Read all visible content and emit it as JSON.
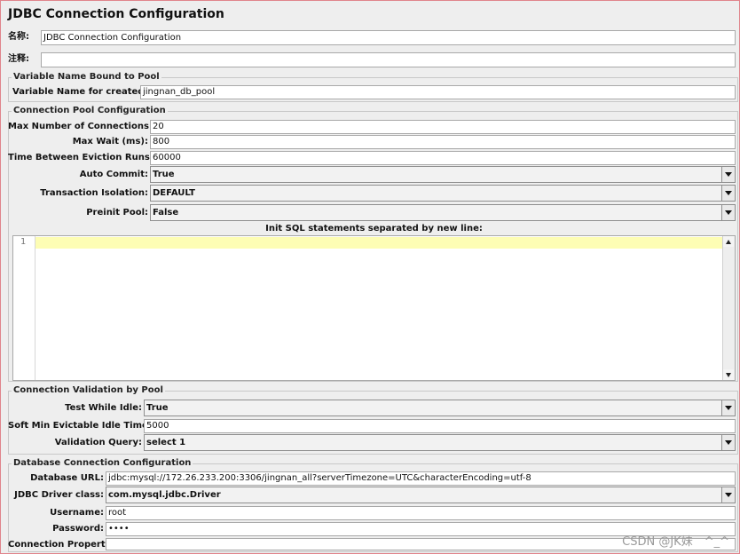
{
  "title": "JDBC Connection Configuration",
  "name": {
    "label": "名称:",
    "value": "JDBC Connection Configuration"
  },
  "comments": {
    "label": "注释:",
    "value": ""
  },
  "variable_group": {
    "title": "Variable Name Bound to Pool",
    "label": "Variable Name for created pool:",
    "value": "jingnan_db_pool"
  },
  "pool_group": {
    "title": "Connection Pool Configuration",
    "max_connections": {
      "label": "Max Number of Connections:",
      "value": "20"
    },
    "max_wait": {
      "label": "Max Wait (ms):",
      "value": "800"
    },
    "eviction": {
      "label": "Time Between Eviction Runs (ms):",
      "value": "60000"
    },
    "auto_commit": {
      "label": "Auto Commit:",
      "value": "True"
    },
    "isolation": {
      "label": "Transaction Isolation:",
      "value": "DEFAULT"
    },
    "preinit": {
      "label": "Preinit Pool:",
      "value": "False"
    },
    "init_sql_label": "Init SQL statements separated by new line:",
    "editor_line": "1"
  },
  "validation_group": {
    "title": "Connection Validation by Pool",
    "test_idle": {
      "label": "Test While Idle:",
      "value": "True"
    },
    "soft_min": {
      "label": "Soft Min Evictable Idle Time(ms):",
      "value": "5000"
    },
    "validation_query": {
      "label": "Validation Query:",
      "value": "select 1"
    }
  },
  "db_group": {
    "title": "Database Connection Configuration",
    "url": {
      "label": "Database URL:",
      "value": "jdbc:mysql://172.26.233.200:3306/jingnan_all?serverTimezone=UTC&characterEncoding=utf-8"
    },
    "driver": {
      "label": "JDBC Driver class:",
      "value": "com.mysql.jdbc.Driver"
    },
    "username": {
      "label": "Username:",
      "value": "root"
    },
    "password": {
      "label": "Password:",
      "value": "••••"
    },
    "props": {
      "label": "Connection Properties:",
      "value": ""
    }
  },
  "watermark": "CSDN @JK妹　^_^",
  "colors": {
    "highlight_line": "#fdfdb4",
    "frame": "#e0848c",
    "background": "#eeeeee"
  }
}
